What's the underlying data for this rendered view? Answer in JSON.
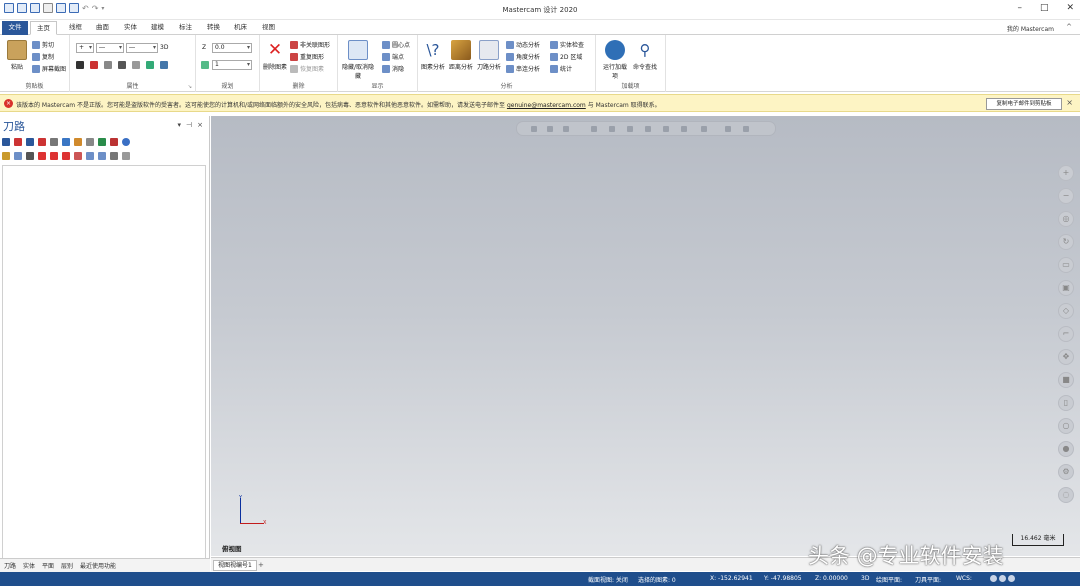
{
  "window": {
    "title": "Mastercam 设计 2020"
  },
  "tabs": [
    "文件",
    "主页",
    "线框",
    "曲面",
    "实体",
    "建模",
    "标注",
    "转换",
    "机床",
    "视图"
  ],
  "my_mastercam": "我的 Mastercam",
  "ribbon": {
    "clipboard": {
      "paste": "粘贴",
      "cut": "剪切",
      "copy": "复制",
      "copy_image": "屏幕截图",
      "label": "剪贴板"
    },
    "attributes": {
      "label": "属性",
      "level_3d": "3D"
    },
    "planning": {
      "label": "规划",
      "z_label": "Z",
      "z_value": "0.0",
      "level_value": "1"
    },
    "delete": {
      "big": "删除图素",
      "items": [
        "非关联图形",
        "重复图形",
        "恢复图素"
      ],
      "label": "删除"
    },
    "display": {
      "big": "隐藏/取消隐藏",
      "items": [
        "圆心点",
        "端点",
        "消隐"
      ],
      "label": "显示"
    },
    "analyze": {
      "big": [
        "图素分析",
        "距离分析",
        "刀路分析"
      ],
      "items": [
        "动态分析",
        "角度分析",
        "串连分析",
        "实体检查",
        "2D 区域",
        "统计"
      ],
      "label": "分析"
    },
    "addins": {
      "big": [
        "运行加载项",
        "命令查找"
      ],
      "label": "加载项"
    }
  },
  "infobar": {
    "text_before": "该版本的 Mastercam 不是正版。您可能是盗版软件的受害者。这可能使您的计算机和/或网络面临额外的安全风险，包括病毒、恶意软件和其他恶意软件。如需帮助，请发送电子邮件至 ",
    "email": "genuine@mastercam.com",
    "text_after": " 与 Mastercam 取得联系。",
    "button": "复制电子邮件到剪贴板"
  },
  "panel": {
    "title": "刀路",
    "bottom_tabs": [
      "刀路",
      "实体",
      "平面",
      "层别",
      "最近使用功能"
    ]
  },
  "graphics": {
    "view_name": "俯视图",
    "axis_y": "Y",
    "axis_x": "X",
    "scale": "16.462 毫米",
    "viewport_tab": "视图视编号1"
  },
  "watermark": "头条 @专业软件安装",
  "status": {
    "view": "截面视图: 关闭",
    "selected": "选择的图素: 0",
    "x": "X: -152.62941",
    "y": "Y: -47.98805",
    "z": "Z: 0.00000",
    "mode": "3D",
    "gplane": "绘图平面:",
    "tplane": "刀具平面:",
    "wcs": "WCS:"
  }
}
